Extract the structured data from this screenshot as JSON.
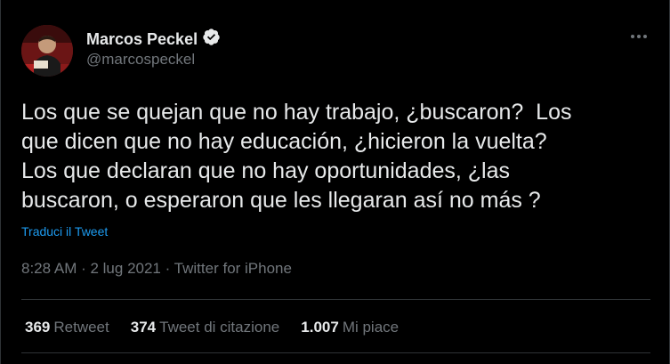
{
  "tweet": {
    "author_name": "Marcos Peckel",
    "author_handle": "@marcospeckel",
    "verified": true,
    "text": "Los que se quejan que no hay trabajo, ¿buscaron?  Los\nque dicen que no hay educación, ¿hicieron la vuelta?\nLos que declaran que no hay oportunidades, ¿las\nbuscaron, o esperaron que les llegaran así no más ?",
    "translate_label": "Traduci il Tweet",
    "meta": "8:28 AM · 2 lug 2021 · Twitter for iPhone"
  },
  "stats": [
    {
      "count": "369",
      "label": "Retweet"
    },
    {
      "count": "374",
      "label": "Tweet di citazione"
    },
    {
      "count": "1.007",
      "label": "Mi piace"
    }
  ],
  "icons": {
    "verified": "verified-badge-icon",
    "more": "more-horizontal-icon"
  },
  "colors": {
    "background": "#000000",
    "text_primary": "#e7e9ea",
    "text_secondary": "#71767b",
    "link": "#1d9bf0",
    "divider": "#2f3336"
  }
}
